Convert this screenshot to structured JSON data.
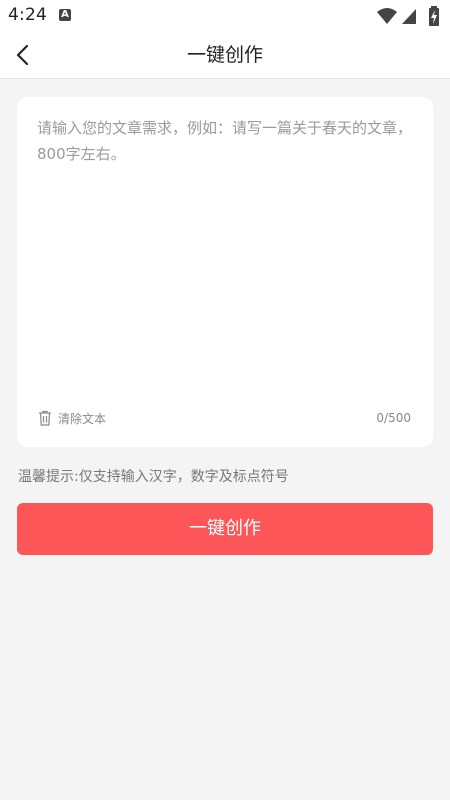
{
  "status_bar": {
    "time": "4:24",
    "notification_icon_letter": "A",
    "icons": [
      "wifi-icon",
      "signal-icon",
      "battery-charging-icon"
    ]
  },
  "header": {
    "title": "一键创作",
    "back_icon": "chevron-left-icon"
  },
  "editor": {
    "placeholder": "请输入您的文章需求，例如：请写一篇关于春天的文章，800字左右。",
    "value": "",
    "clear_label": "清除文本",
    "clear_icon": "trash-icon",
    "counter": "0/500"
  },
  "tip": {
    "text": "温馨提示:仅支持输入汉字，数字及标点符号"
  },
  "actions": {
    "create_label": "一键创作"
  },
  "colors": {
    "accent": "#fe5658",
    "background": "#f4f4f4",
    "card": "#ffffff",
    "placeholder": "#9a9a9a"
  }
}
